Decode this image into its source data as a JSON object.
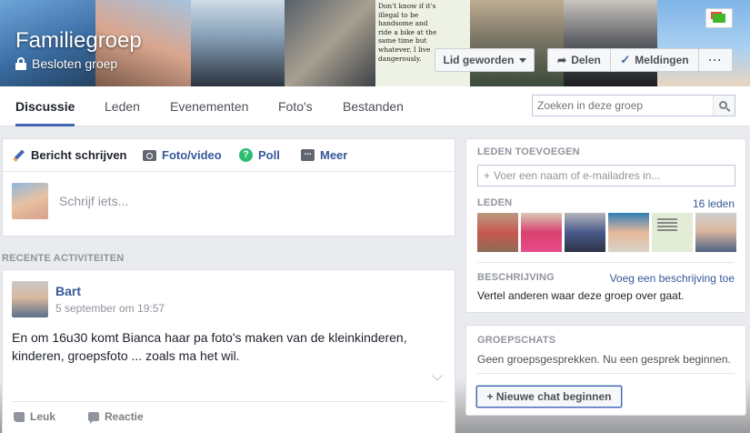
{
  "cover": {
    "quote": "Don't know if it's illegal to be handsome and ride a bike at the same time but whatever, I live dangerously."
  },
  "group": {
    "title": "Familiegroep",
    "privacy": "Besloten groep"
  },
  "cover_buttons": {
    "join": "Lid geworden",
    "share": "Delen",
    "notifications": "Meldingen",
    "more": "···"
  },
  "nav": {
    "tabs": [
      {
        "label": "Discussie",
        "active": true
      },
      {
        "label": "Leden"
      },
      {
        "label": "Evenementen"
      },
      {
        "label": "Foto's"
      },
      {
        "label": "Bestanden"
      }
    ],
    "search_placeholder": "Zoeken in deze groep"
  },
  "composer": {
    "tabs": [
      "Bericht schrijven",
      "Foto/video",
      "Poll",
      "Meer"
    ],
    "placeholder": "Schrijf iets..."
  },
  "activity": {
    "label": "RECENTE ACTIVITEITEN",
    "post": {
      "author": "Bart",
      "time": "5 september om 19:57",
      "text": "En om 16u30 komt Bianca haar pa foto's maken van de kleinkinderen, kinderen, groepsfoto ... zoals ma het wil.",
      "like": "Leuk",
      "comment": "Reactie"
    }
  },
  "sidebar": {
    "add_members_label": "LEDEN TOEVOEGEN",
    "add_members_placeholder": "Voer een naam of e-mailadres in...",
    "add_plus": "+",
    "members_label": "LEDEN",
    "members_count": "16 leden",
    "description_label": "BESCHRIJVING",
    "description_link": "Voeg een beschrijving toe",
    "description_text": "Vertel anderen waar deze groep over gaat.",
    "chats_label": "GROEPSCHATS",
    "chats_empty": "Geen groepsgesprekken. Nu een gesprek beginnen.",
    "chat_button": "+ Nieuwe chat beginnen"
  },
  "colors": {
    "accent": "#4267b2",
    "link": "#365899",
    "background": "#e9ebee"
  }
}
